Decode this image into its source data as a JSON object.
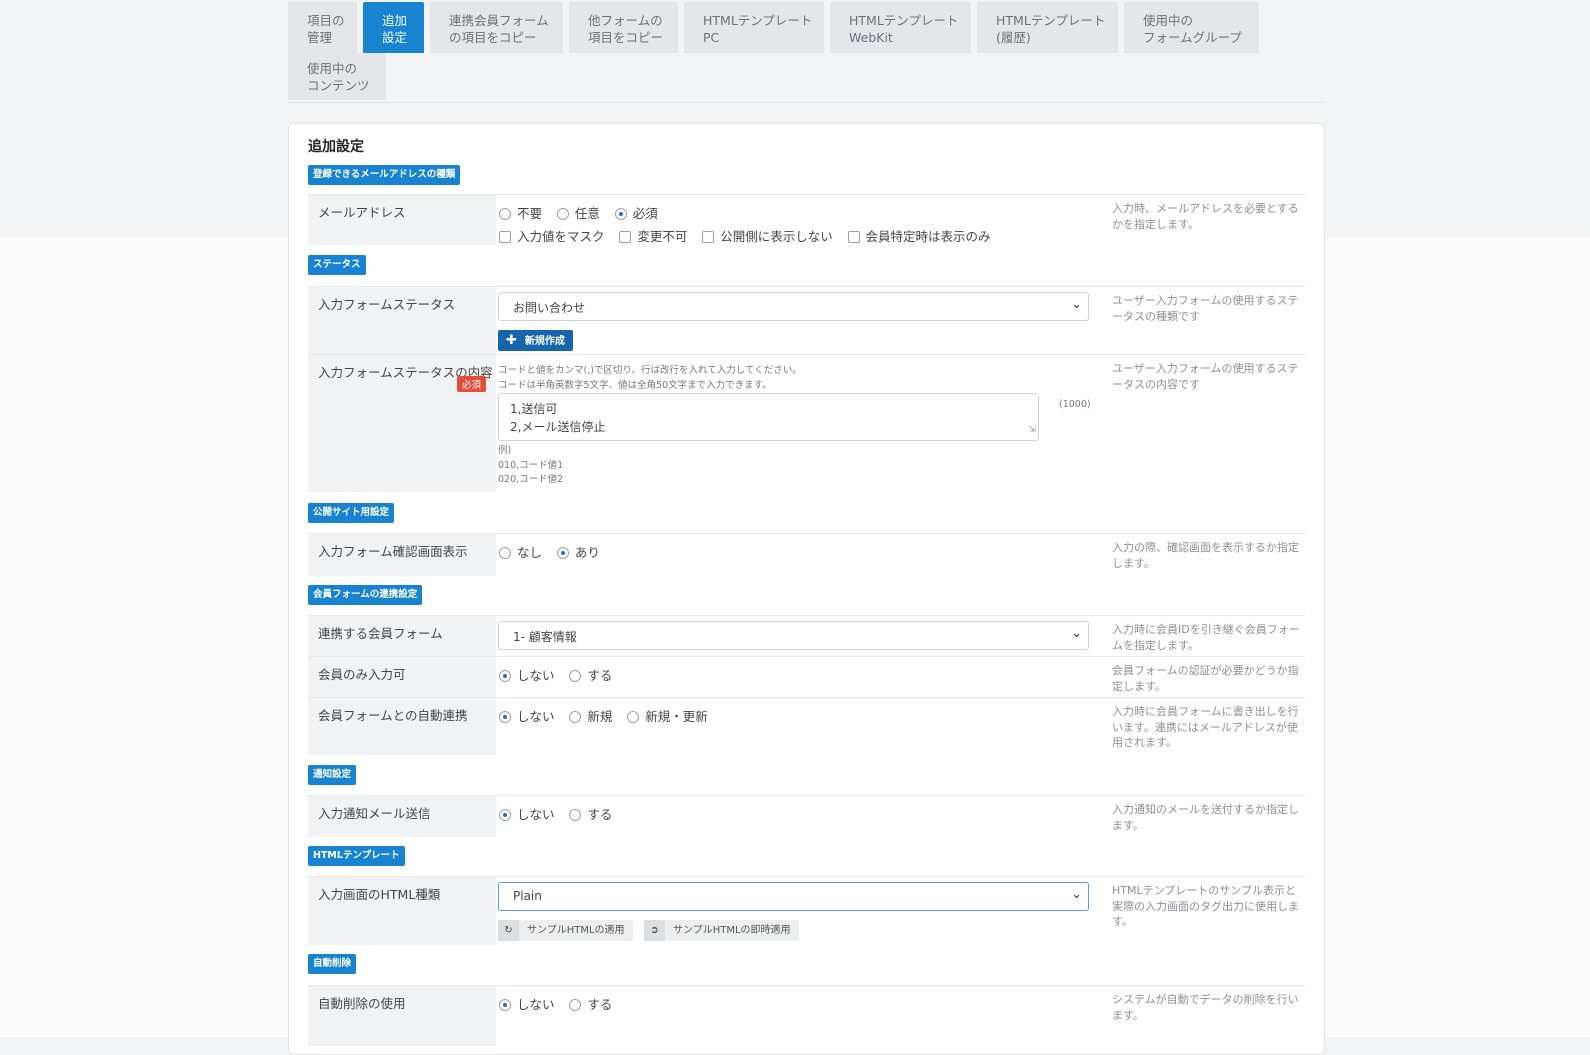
{
  "tabs": [
    {
      "line1": "項目の",
      "line2": "管理"
    },
    {
      "line1": "追加",
      "line2": "設定"
    },
    {
      "line1": "連携会員フォーム",
      "line2": "の項目をコピー"
    },
    {
      "line1": "他フォームの",
      "line2": "項目をコピー"
    },
    {
      "line1": "HTMLテンプレート",
      "line2": "PC"
    },
    {
      "line1": "HTMLテンプレート",
      "line2": "WebKit"
    },
    {
      "line1": "HTMLテンプレート",
      "line2": "(履歴)"
    },
    {
      "line1": "使用中の",
      "line2": "フォームグループ"
    },
    {
      "line1": "使用中の",
      "line2": "コンテンツ"
    }
  ],
  "active_tab": "追加設定",
  "panel_title": "追加設定",
  "sections": {
    "mail": "登録できるメールアドレスの種類",
    "status": "ステータス",
    "public": "公開サイト用設定",
    "member": "会員フォームの連携設定",
    "notify": "通知設定",
    "html": "HTMLテンプレート",
    "autodelete": "自動削除"
  },
  "email": {
    "label": "メールアドレス",
    "radios": [
      "不要",
      "任意",
      "必須"
    ],
    "selected": "必須",
    "checks": [
      "入力値をマスク",
      "変更不可",
      "公開側に表示しない",
      "会員特定時は表示のみ"
    ],
    "help": "入力時、メールアドレスを必要とするかを指定します。"
  },
  "status_form": {
    "label": "入力フォームステータス",
    "value": "お問い合わせ",
    "new_button": "新規作成",
    "help": "ユーザー入力フォームの使用するステータスの種類です"
  },
  "status_content": {
    "label": "入力フォームステータスの内容",
    "required": "必須",
    "note1": "コードと値をカンマ(,)で区切り、行は改行を入れて入力してください。",
    "note2": "コードは半角英数字5文字、値は全角50文字まで入力できます。",
    "line1": "1,送信可",
    "line2": "2,メール送信停止",
    "counter": "(1000)",
    "ex1": "例)",
    "ex2": "010,コード値1",
    "ex3": "020,コード値2",
    "help": "ユーザー入力フォームの使用するステータスの内容です"
  },
  "confirm": {
    "label": "入力フォーム確認画面表示",
    "radios": [
      "なし",
      "あり"
    ],
    "selected": "あり",
    "help": "入力の際、確認画面を表示するか指定します。"
  },
  "member_form": {
    "label": "連携する会員フォーム",
    "value": "1- 顧客情報",
    "help": "入力時に会員IDを引き継ぐ会員フォームを指定します。"
  },
  "member_only": {
    "label": "会員のみ入力可",
    "radios": [
      "しない",
      "する"
    ],
    "selected": "しない",
    "help": "会員フォームの認証が必要かどうか指定します。"
  },
  "auto_link": {
    "label": "会員フォームとの自動連携",
    "radios": [
      "しない",
      "新規",
      "新規・更新"
    ],
    "selected": "しない",
    "help": "入力時に会員フォームに書き出しを行います。連携にはメールアドレスが使用されます。"
  },
  "notify_mail": {
    "label": "入力通知メール送信",
    "radios": [
      "しない",
      "する"
    ],
    "selected": "しない",
    "help": "入力通知のメールを送付するか指定します。"
  },
  "html_type": {
    "label": "入力画面のHTML種類",
    "value": "Plain",
    "btn_apply": "サンプルHTMLの適用",
    "btn_apply_now": "サンプルHTMLの即時適用",
    "help": "HTMLテンプレートのサンプル表示と実際の入力画面のタグ出力に使用します。"
  },
  "auto_delete": {
    "label": "自動削除の使用",
    "radios": [
      "しない",
      "する"
    ],
    "selected": "しない",
    "help": "システムが自動でデータの削除を行います。"
  },
  "colors": {
    "accent": "#1883d0",
    "button": "#1766ad",
    "required": "#e34d3e"
  }
}
